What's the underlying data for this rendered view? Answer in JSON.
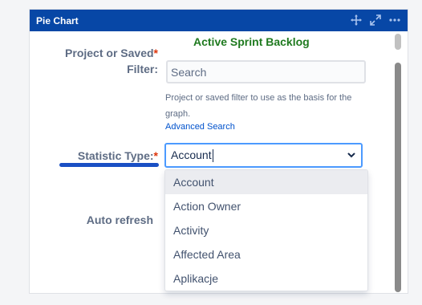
{
  "gadget": {
    "title": "Pie Chart",
    "icons": [
      "move-icon",
      "expand-icon",
      "more-icon"
    ]
  },
  "form": {
    "project_label": "Project or Saved",
    "project_label_line2": "Filter:",
    "required_marker": "*",
    "selected_filter": "Active Sprint Backlog",
    "search_placeholder": "Search",
    "help_text": "Project or saved filter to use as the basis for the graph.",
    "advanced_search": "Advanced Search",
    "statistic_label": "Statistic Type:",
    "statistic_value": "Account",
    "auto_refresh_label": "Auto refresh"
  },
  "dropdown": {
    "options": [
      "Account",
      "Action Owner",
      "Activity",
      "Affected Area",
      "Aplikacje"
    ],
    "selected": "Account"
  },
  "colors": {
    "titlebar": "#0747a6",
    "link": "#0052cc",
    "filter_name": "#1f7a1f",
    "required": "#de350b",
    "focus_border": "#4c9aff"
  }
}
